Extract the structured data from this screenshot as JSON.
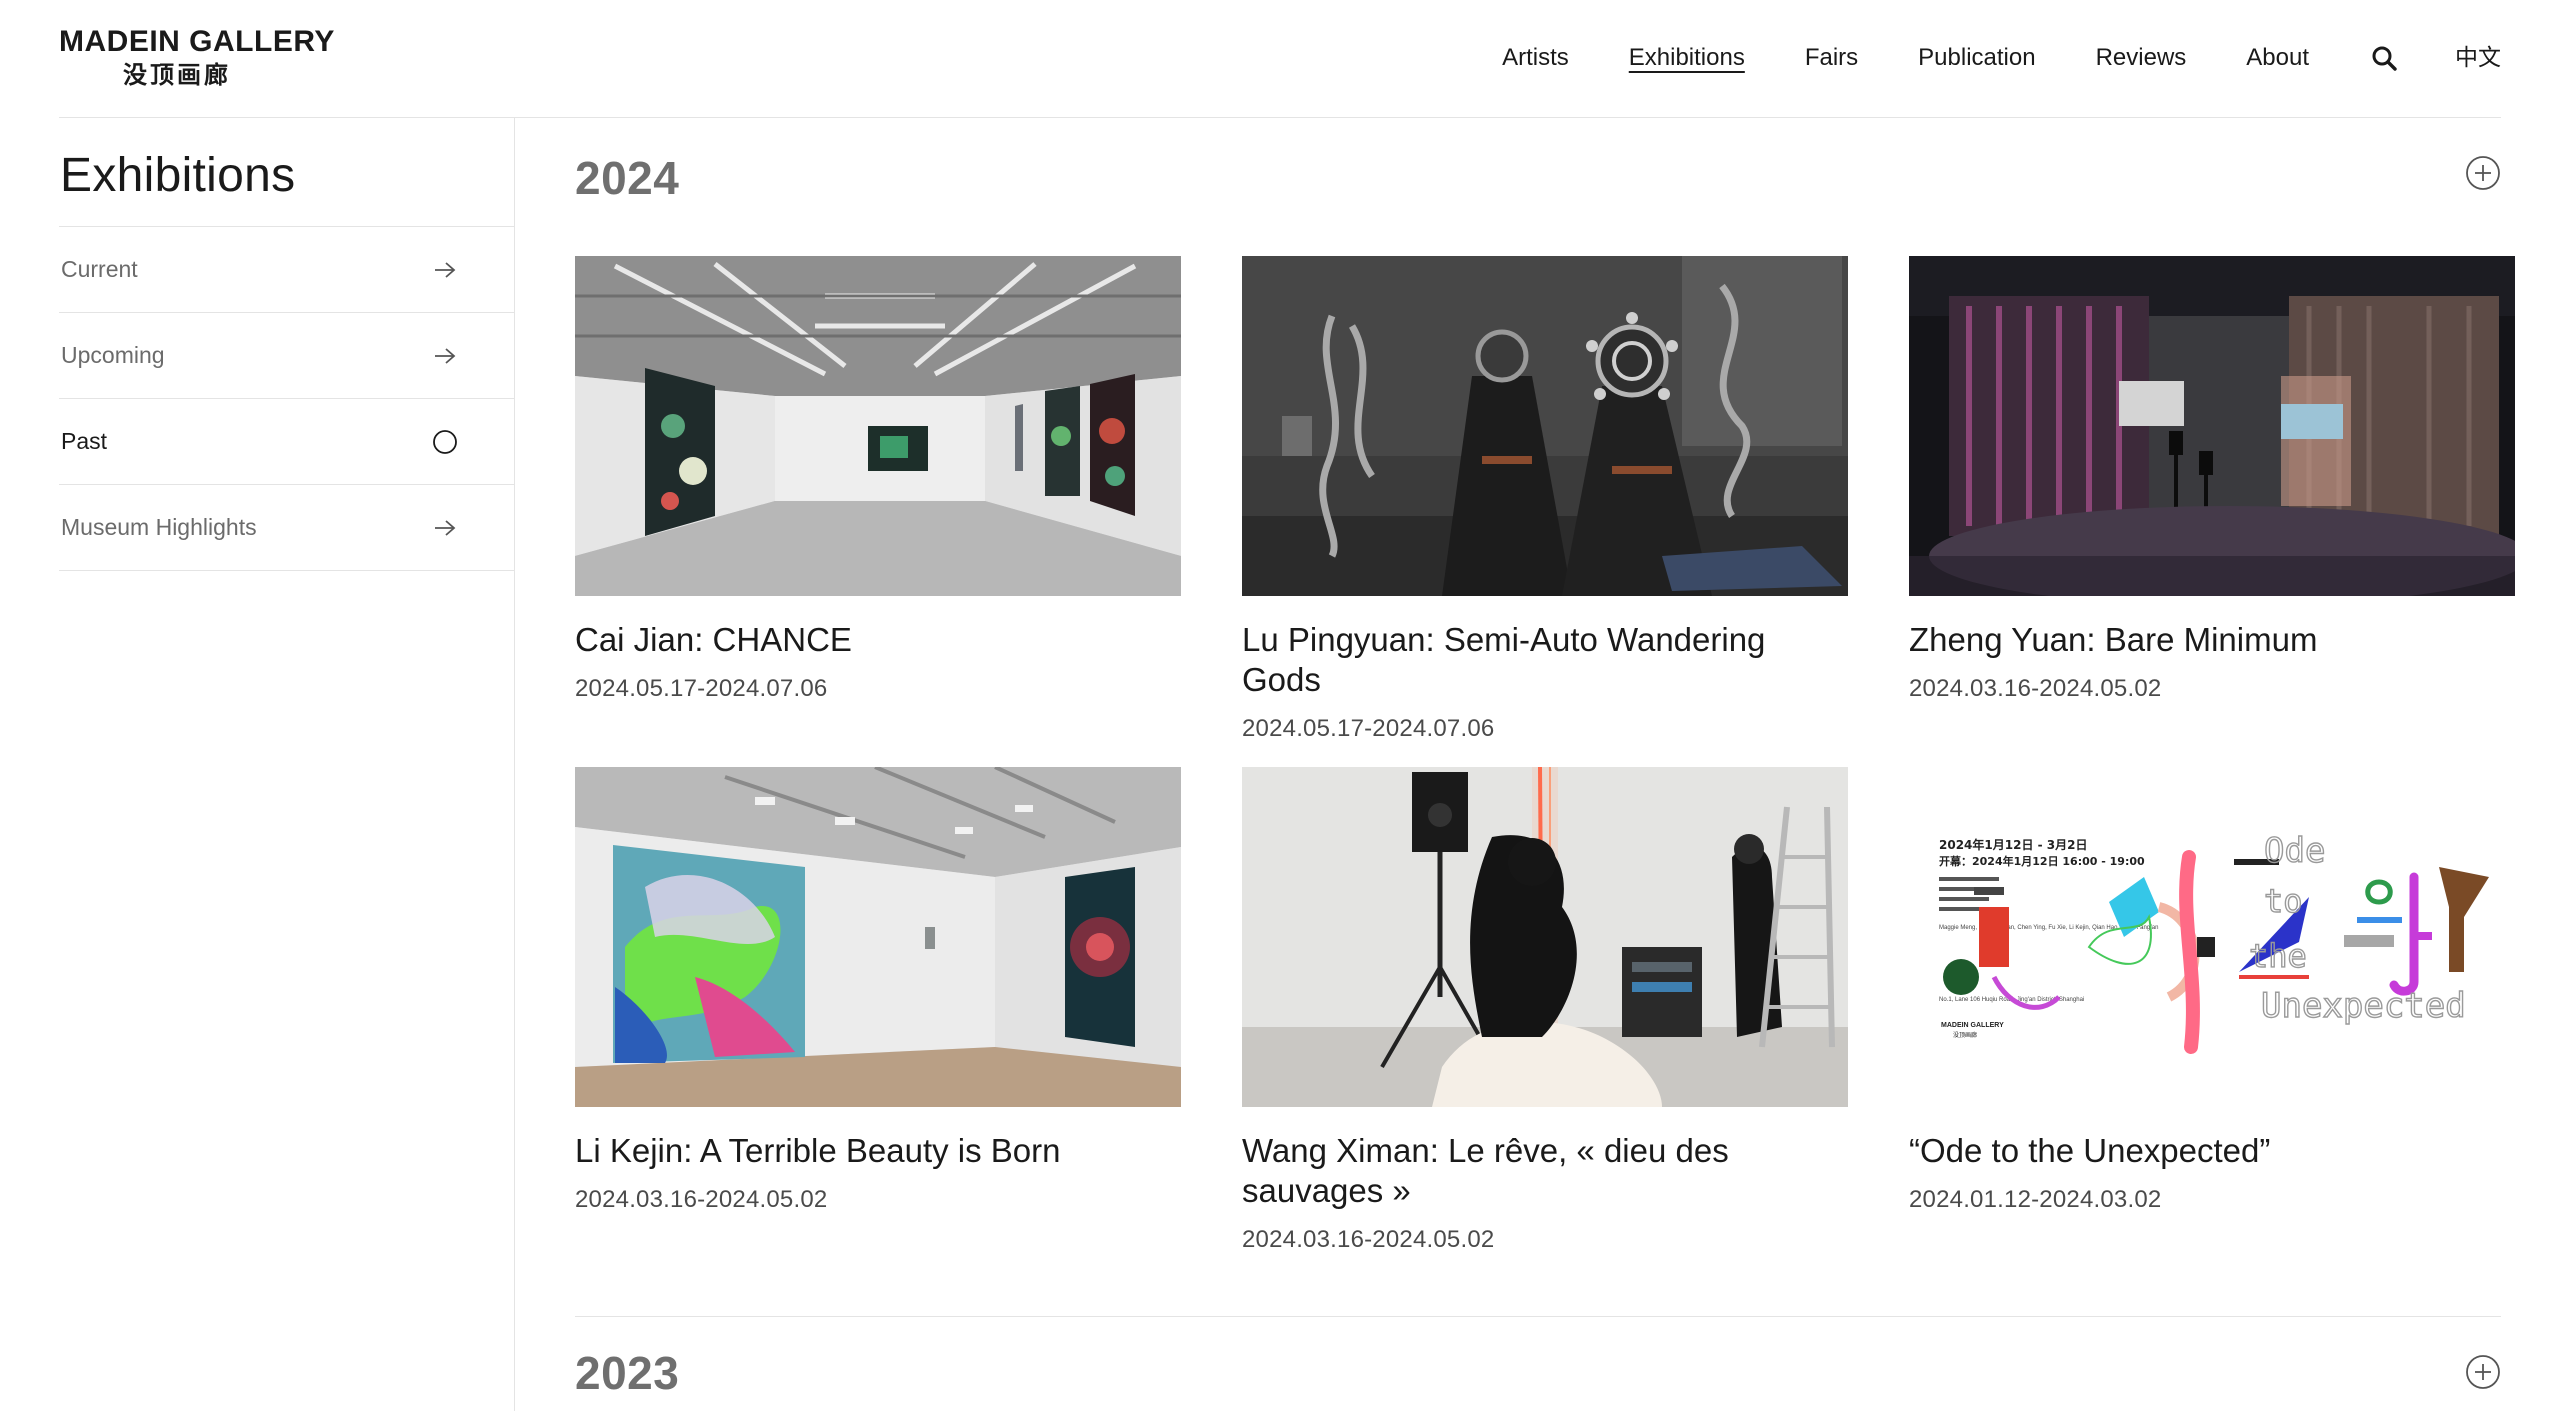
{
  "brand": {
    "name_en": "MADEIN GALLERY",
    "name_zh": "没顶画廊"
  },
  "nav": {
    "items": [
      {
        "label": "Artists"
      },
      {
        "label": "Exhibitions",
        "active": true
      },
      {
        "label": "Fairs"
      },
      {
        "label": "Publication"
      },
      {
        "label": "Reviews"
      },
      {
        "label": "About"
      }
    ],
    "search_icon": "search-icon",
    "language": "中文"
  },
  "sidebar": {
    "title": "Exhibitions",
    "items": [
      {
        "label": "Current",
        "icon": "arrow-right-icon"
      },
      {
        "label": "Upcoming",
        "icon": "arrow-right-icon"
      },
      {
        "label": "Past",
        "icon": "circle-icon",
        "active": true
      },
      {
        "label": "Museum Highlights",
        "icon": "arrow-right-icon"
      }
    ]
  },
  "sections": [
    {
      "year": "2024",
      "toggle_icon": "plus-circle-icon",
      "exhibitions": [
        {
          "title": "Cai Jian: CHANCE",
          "dates": "2024.05.17-2024.07.06"
        },
        {
          "title": "Lu Pingyuan: Semi-Auto Wandering Gods",
          "dates": "2024.05.17-2024.07.06"
        },
        {
          "title": "Zheng Yuan: Bare Minimum",
          "dates": "2024.03.16-2024.05.02"
        },
        {
          "title": "Li Kejin: A Terrible Beauty is Born",
          "dates": "2024.03.16-2024.05.02"
        },
        {
          "title": "Wang Ximan: Le rêve, « dieu des sauvages »",
          "dates": "2024.03.16-2024.05.02"
        },
        {
          "title": "“Ode to the Unexpected”",
          "dates": "2024.01.12-2024.03.02"
        }
      ],
      "poster": {
        "line1": "2024年1月12日 - 3月2日",
        "line2": "开幕：2024年1月12日 16:00 - 19:00",
        "names": "Maggie Meng, Chen Ruofan, Chen Ying, Fu Xie, Li Kejin, Qian Hao, Shao Fangfan",
        "address": "No.1, Lane 106 Huqiu Road, Jing'an District, Shanghai",
        "brand_en": "MADEIN GALLERY",
        "brand_zh": "没顶画廊",
        "word1": "Ode",
        "word2": "to",
        "word3": "the",
        "word4": "Unexpected"
      }
    },
    {
      "year": "2023",
      "toggle_icon": "plus-circle-icon"
    }
  ]
}
